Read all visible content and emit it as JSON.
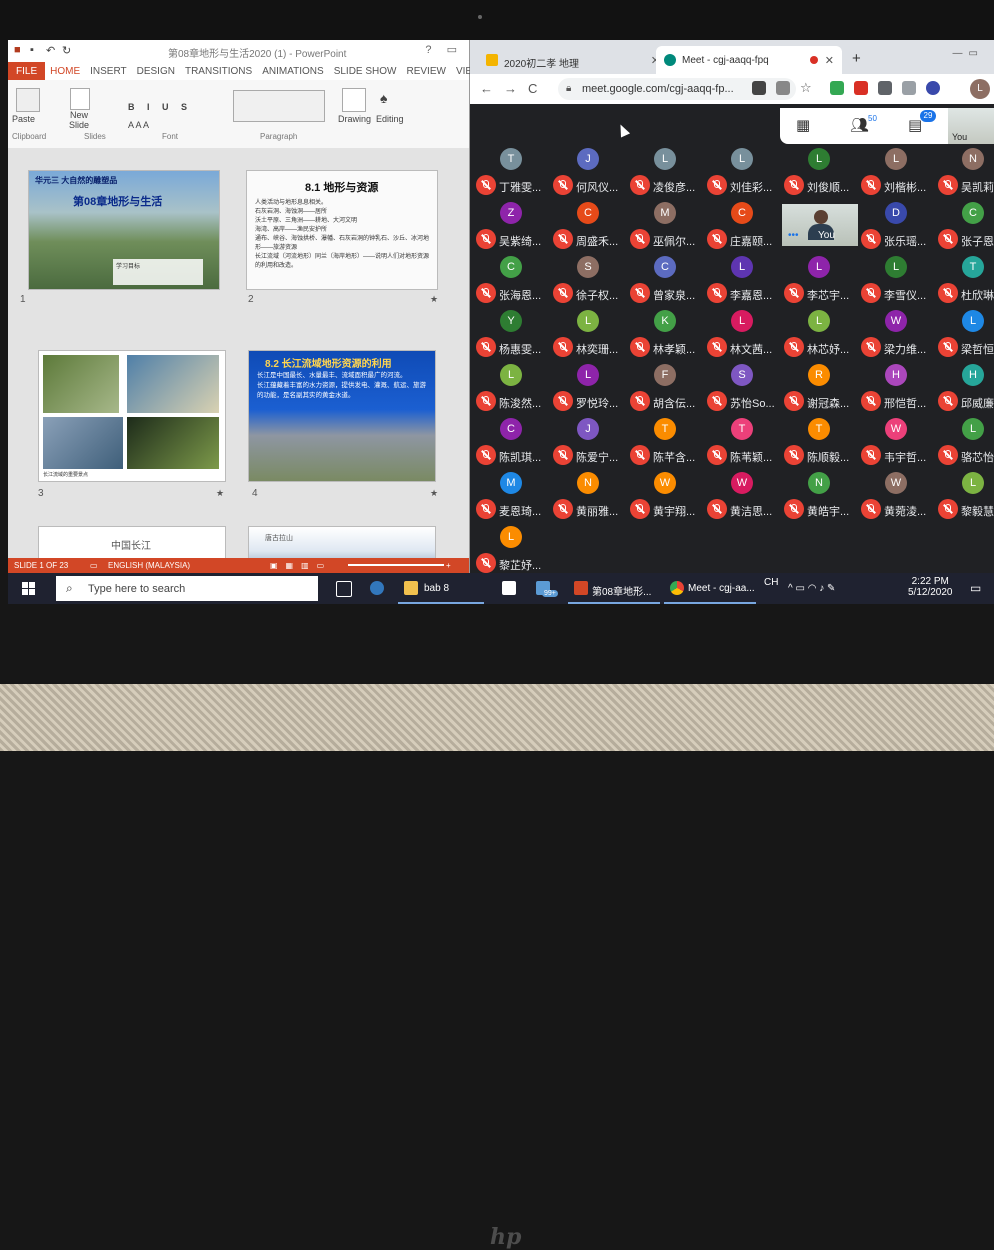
{
  "powerpoint": {
    "title": "第08章地形与生活2020 (1) - PowerPoint",
    "window_controls": "? ▭",
    "tabs": [
      "FILE",
      "HOME",
      "INSERT",
      "DESIGN",
      "TRANSITIONS",
      "ANIMATIONS",
      "SLIDE SHOW",
      "REVIEW",
      "VIEW",
      "suyii"
    ],
    "ribbon": {
      "paste": "Paste",
      "new_slide": "New Slide",
      "drawing": "Drawing",
      "editing": "Editing",
      "groups": [
        "Clipboard",
        "Slides",
        "Font",
        "Paragraph"
      ]
    },
    "slides": [
      {
        "num": "1",
        "title": "华元三 大自然的雕塑品",
        "heading": "第08章地形与生活",
        "caption": "学习目标"
      },
      {
        "num": "2",
        "title": "8.1 地形与资源",
        "bullets": [
          "人类活动与地形息息相关。",
          "石灰岩洞、海蚀洞——居所",
          "沃土平原、三角洲——耕地、大河文明",
          "海湾、高岸——渔民安护所",
          "通布、峡谷、海蚀拱桥、瀑幡、石灰岩洞的钟乳石、沙丘、冰河地形——旅游资源",
          "长江流域（河流地形）同兰（海岸地形）——说明人们对地形资源的利用和改造。"
        ]
      },
      {
        "num": "3",
        "caption": "长江流域的重要景点"
      },
      {
        "num": "4",
        "title": "8.2 长江流域地形资源的利用",
        "bullets": [
          "长江是中国最长、水量最丰、流域面积最广的河流。",
          "长江蕴藏着丰富的水力资源，提供发电、灌溉、航运、旅游的功能，是名副其实的黄金水道。"
        ]
      },
      {
        "num": "5",
        "title": "中国长江"
      },
      {
        "num": "6",
        "title": "唐古拉山"
      }
    ],
    "status": {
      "slide": "SLIDE 1 OF 23",
      "language": "ENGLISH (MALAYSIA)"
    }
  },
  "chrome": {
    "tabs": [
      {
        "label": "2020初二孝 地理",
        "active": false
      },
      {
        "label": "Meet - cgj-aaqq-fpq",
        "active": true
      }
    ],
    "url": "meet.google.com/cgj-aaqq-fp...",
    "profile_initial": "L"
  },
  "meet": {
    "people_count": "50",
    "chat_count": "29",
    "self_label": "You",
    "participants": [
      {
        "initial": "T",
        "name": "丁雅雯...",
        "color": "#78909c"
      },
      {
        "initial": "J",
        "name": "何风仪...",
        "color": "#5c6bc0"
      },
      {
        "initial": "L",
        "name": "凌俊彦...",
        "color": "#78909c"
      },
      {
        "initial": "L",
        "name": "刘佳彩...",
        "color": "#78909c"
      },
      {
        "initial": "L",
        "name": "刘俊顺...",
        "color": "#2e7d32"
      },
      {
        "initial": "L",
        "name": "刘楷彬...",
        "color": "#8d6e63"
      },
      {
        "initial": "N",
        "name": "吴凯莉...",
        "color": "#8d6e63"
      },
      {
        "initial": "Z",
        "name": "吴紫绮...",
        "color": "#8e24aa"
      },
      {
        "initial": "C",
        "name": "周盛禾...",
        "color": "#e64a19"
      },
      {
        "initial": "M",
        "name": "巫佩尔...",
        "color": "#8d6e63"
      },
      {
        "initial": "C",
        "name": "庄嘉颐...",
        "color": "#e64a19"
      },
      {
        "initial": "",
        "name": "You",
        "color": "",
        "self": true
      },
      {
        "initial": "D",
        "name": "张乐瑶...",
        "color": "#3949ab"
      },
      {
        "initial": "C",
        "name": "张子恩...",
        "color": "#43a047"
      },
      {
        "initial": "C",
        "name": "张海恩...",
        "color": "#43a047"
      },
      {
        "initial": "S",
        "name": "徐子权...",
        "color": "#8d6e63"
      },
      {
        "initial": "C",
        "name": "曾家泉...",
        "color": "#5c6bc0"
      },
      {
        "initial": "L",
        "name": "李嘉恩...",
        "color": "#5e35b1"
      },
      {
        "initial": "L",
        "name": "李芯宇...",
        "color": "#8e24aa"
      },
      {
        "initial": "L",
        "name": "李雪仪...",
        "color": "#2e7d32"
      },
      {
        "initial": "T",
        "name": "杜欣琳...",
        "color": "#26a69a"
      },
      {
        "initial": "Y",
        "name": "杨惠雯...",
        "color": "#2e7d32"
      },
      {
        "initial": "L",
        "name": "林奕珊...",
        "color": "#7cb342"
      },
      {
        "initial": "K",
        "name": "林孝颖...",
        "color": "#43a047"
      },
      {
        "initial": "L",
        "name": "林文茜...",
        "color": "#d81b60"
      },
      {
        "initial": "L",
        "name": "林芯妤...",
        "color": "#7cb342"
      },
      {
        "initial": "W",
        "name": "梁力维...",
        "color": "#8e24aa"
      },
      {
        "initial": "L",
        "name": "梁哲恒...",
        "color": "#1e88e5"
      },
      {
        "initial": "L",
        "name": "陈浚然...",
        "color": "#7cb342"
      },
      {
        "initial": "L",
        "name": "罗悦玲...",
        "color": "#8e24aa"
      },
      {
        "initial": "F",
        "name": "胡含伝...",
        "color": "#8d6e63"
      },
      {
        "initial": "S",
        "name": "苏怡So...",
        "color": "#7e57c2"
      },
      {
        "initial": "R",
        "name": "谢冠森...",
        "color": "#fb8c00"
      },
      {
        "initial": "H",
        "name": "邢恺哲...",
        "color": "#ab47bc"
      },
      {
        "initial": "H",
        "name": "邱威廉...",
        "color": "#26a69a"
      },
      {
        "initial": "C",
        "name": "陈凯琪...",
        "color": "#8e24aa"
      },
      {
        "initial": "J",
        "name": "陈爱宁...",
        "color": "#7e57c2"
      },
      {
        "initial": "T",
        "name": "陈芊含...",
        "color": "#fb8c00"
      },
      {
        "initial": "T",
        "name": "陈苇颖...",
        "color": "#ec407a"
      },
      {
        "initial": "T",
        "name": "陈顺毅...",
        "color": "#fb8c00"
      },
      {
        "initial": "W",
        "name": "韦宇哲...",
        "color": "#ec407a"
      },
      {
        "initial": "L",
        "name": "骆芯怡...",
        "color": "#43a047"
      },
      {
        "initial": "M",
        "name": "麦恩琦...",
        "color": "#1e88e5"
      },
      {
        "initial": "N",
        "name": "黄丽雅...",
        "color": "#fb8c00"
      },
      {
        "initial": "W",
        "name": "黄宇翔...",
        "color": "#fb8c00"
      },
      {
        "initial": "W",
        "name": "黄洁思...",
        "color": "#d81b60"
      },
      {
        "initial": "N",
        "name": "黄皓宇...",
        "color": "#43a047"
      },
      {
        "initial": "W",
        "name": "黄菀淩...",
        "color": "#8d6e63"
      },
      {
        "initial": "L",
        "name": "黎毅慧...",
        "color": "#7cb342"
      },
      {
        "initial": "L",
        "name": "黎芷妤...",
        "color": "#fb8c00"
      }
    ]
  },
  "taskbar": {
    "search_placeholder": "Type here to search",
    "items": [
      "bab 8",
      "第08章地形...",
      "Meet - cgj-aa..."
    ],
    "store_badge": "99+",
    "lang": "CH",
    "time": "2:22 PM",
    "date": "5/12/2020"
  }
}
